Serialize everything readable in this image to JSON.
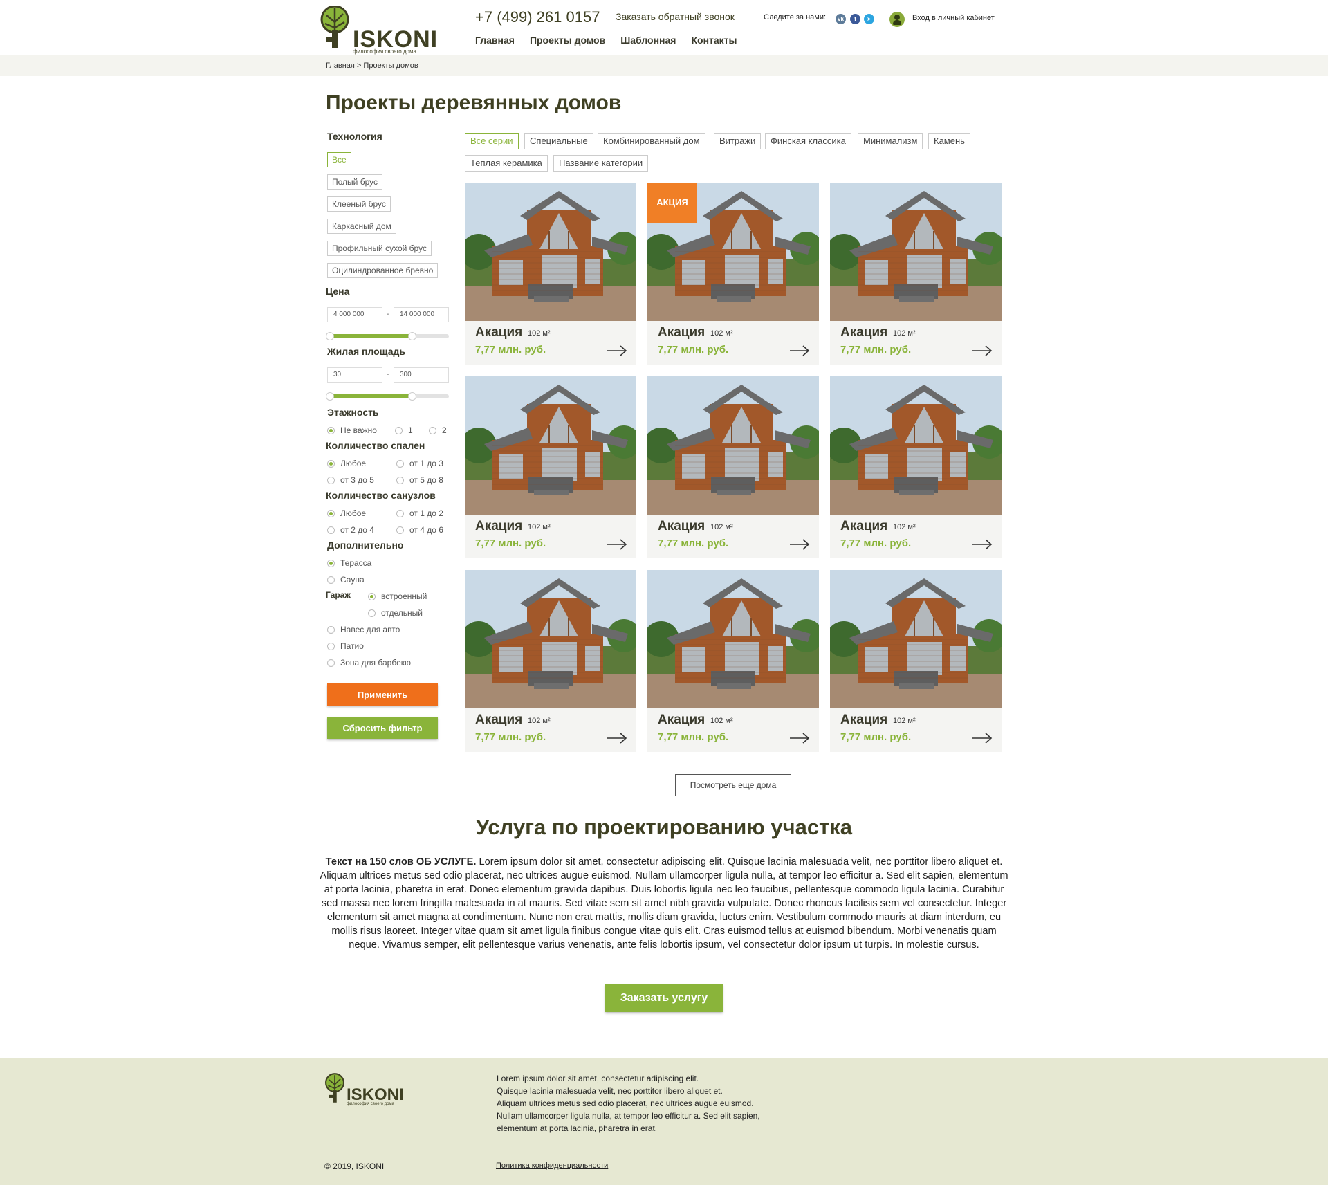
{
  "header": {
    "logo_text": "ISKONI",
    "logo_subtitle": "философия своего дома",
    "phone": "+7 (499) 261 0157",
    "callback": "Заказать обратный звонок",
    "follow": "Следите за нами:",
    "social": [
      {
        "icon": "vk-icon",
        "label": "vk"
      },
      {
        "icon": "facebook-icon",
        "label": "f"
      },
      {
        "icon": "telegram-icon",
        "label": "➤"
      }
    ],
    "login": "Вход в личный кабинет",
    "nav": [
      "Главная",
      "Проекты домов",
      "Шаблонная",
      "Контакты"
    ]
  },
  "breadcrumb": {
    "home": "Главная",
    "sep": " > ",
    "current": "Проекты домов"
  },
  "page_title": "Проекты деревянных домов",
  "filters": {
    "technology": {
      "label": "Технология",
      "options": [
        "Все",
        "Полый брус",
        "Клееный брус",
        "Каркасный дом",
        "Профильный сухой брус",
        "Оцилиндрованное бревно"
      ],
      "selected": "Все"
    },
    "price": {
      "label": "Цена",
      "min": "4 000 000",
      "max": "14 000 000",
      "dash": "-",
      "slider": [
        0.0,
        0.7
      ]
    },
    "area": {
      "label": "Жилая площадь",
      "min": "30",
      "max": "300",
      "dash": "-",
      "slider": [
        0.0,
        0.7
      ]
    },
    "floors": {
      "label": "Этажность",
      "options": [
        "Не важно",
        "1",
        "2"
      ],
      "selected": "Не важно"
    },
    "bedrooms": {
      "label": "Колличество спален",
      "options": [
        "Любое",
        "от 1 до 3",
        "от 3 до 5",
        "от 5 до 8"
      ],
      "selected": "Любое"
    },
    "bathrooms": {
      "label": "Колличество санузлов",
      "options": [
        "Любое",
        "от 1 до 2",
        "от 2 до 4",
        "от 4 до 6"
      ],
      "selected": "Любое"
    },
    "extra": {
      "label": "Дополнительно",
      "terrace": "Терасса",
      "sauna": "Сауна",
      "garage_label": "Гараж",
      "garage_options": [
        "встроенный",
        "отдельный"
      ],
      "carport": "Навес для авто",
      "patio": "Патио",
      "bbq": "Зона для барбекю",
      "selected": [
        "Терасса",
        "встроенный"
      ]
    },
    "apply": "Применить",
    "reset": "Сбросить фильтр"
  },
  "series": {
    "tags": [
      "Все серии",
      "Специальные",
      "Комбинированный дом",
      "Витражи",
      "Финская классика",
      "Минимализм",
      "Камень",
      "Теплая керамика",
      "Название категории"
    ],
    "selected": "Все серии"
  },
  "cards": [
    {
      "title": "Акация",
      "area": "102 м²",
      "price": "7,77 млн. руб.",
      "promo": ""
    },
    {
      "title": "Акация",
      "area": "102 м²",
      "price": "7,77 млн. руб.",
      "promo": "АКЦИЯ"
    },
    {
      "title": "Акация",
      "area": "102 м²",
      "price": "7,77 млн. руб.",
      "promo": ""
    },
    {
      "title": "Акация",
      "area": "102 м²",
      "price": "7,77 млн. руб.",
      "promo": ""
    },
    {
      "title": "Акация",
      "area": "102 м²",
      "price": "7,77 млн. руб.",
      "promo": ""
    },
    {
      "title": "Акация",
      "area": "102 м²",
      "price": "7,77 млн. руб.",
      "promo": ""
    },
    {
      "title": "Акация",
      "area": "102 м²",
      "price": "7,77 млн. руб.",
      "promo": ""
    },
    {
      "title": "Акация",
      "area": "102 м²",
      "price": "7,77 млн. руб.",
      "promo": ""
    },
    {
      "title": "Акация",
      "area": "102 м²",
      "price": "7,77 млн. руб.",
      "promo": ""
    }
  ],
  "more_button": "Посмотреть еще дома",
  "service": {
    "title": "Услуга по проектированию участка",
    "lead": "Текст на 150 слов ОБ УСЛУГЕ.",
    "text": " Lorem ipsum dolor sit amet, consectetur adipiscing elit. Quisque lacinia malesuada velit, nec porttitor libero aliquet et. Aliquam ultrices metus sed odio placerat, nec ultrices augue euismod. Nullam ullamcorper ligula nulla, at tempor leo efficitur a. Sed elit sapien, elementum at porta lacinia, pharetra in erat. Donec elementum gravida dapibus. Duis lobortis ligula nec leo faucibus, pellentesque commodo ligula lacinia. Curabitur sed massa nec lorem fringilla malesuada in at mauris. Sed vitae sem sit amet nibh gravida vulputate. Donec rhoncus facilisis sem vel consectetur. Integer elementum sit amet magna at condimentum. Nunc non erat mattis, mollis diam gravida, luctus enim. Vestibulum commodo mauris at diam interdum, eu mollis risus laoreet. Integer vitae quam sit amet ligula finibus congue vitae quis elit. Cras euismod tellus at euismod bibendum. Morbi venenatis quam neque. Vivamus semper, elit pellentesque varius venenatis, ante felis lobortis ipsum, vel consectetur dolor ipsum ut turpis. In molestie cursus.",
    "button": "Заказать услугу"
  },
  "footer": {
    "logo_text": "ISKONI",
    "logo_subtitle": "философия своего дома",
    "text_lines": [
      "Lorem ipsum dolor sit amet, consectetur adipiscing elit.",
      "Quisque lacinia malesuada velit, nec porttitor libero aliquet et.",
      "Aliquam ultrices metus sed odio placerat, nec ultrices augue euismod.",
      "Nullam ullamcorper ligula nulla, at tempor leo efficitur a. Sed elit sapien,",
      "elementum at porta lacinia, pharetra in erat."
    ],
    "copyright": "© 2019, ISKONI",
    "policy": "Политика конфиденциальности"
  },
  "colors": {
    "accent_green": "#8ab43a",
    "accent_orange": "#ef6f1b",
    "promo_orange": "#f07f26",
    "dark_olive": "#3f4023",
    "footer_bg": "#e6e8d2"
  }
}
